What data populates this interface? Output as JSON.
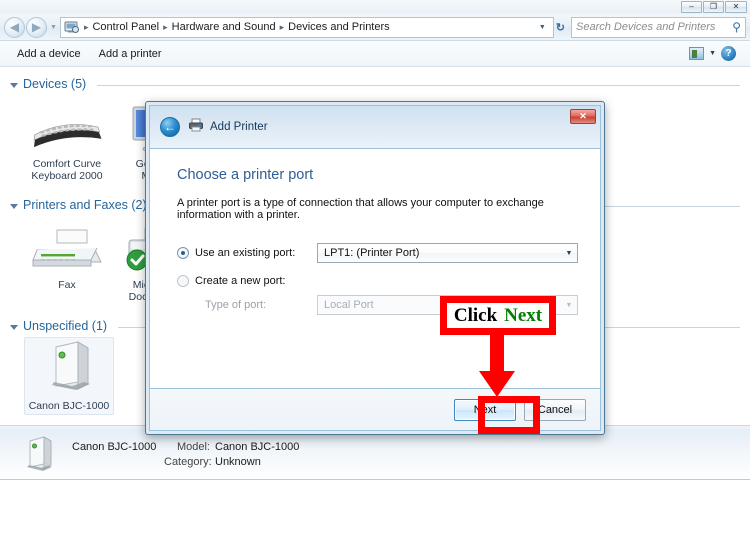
{
  "window": {
    "controls": [
      {
        "name": "minimize",
        "glyph": "–"
      },
      {
        "name": "maximize",
        "glyph": "❐"
      },
      {
        "name": "close",
        "glyph": "✕"
      }
    ]
  },
  "address_bar": {
    "back_glyph": "◀",
    "forward_glyph": "▶",
    "dropdown_glyph": "▼",
    "breadcrumbs": [
      "Control Panel",
      "Hardware and Sound",
      "Devices and Printers"
    ],
    "separator": "▸",
    "caret_glyph": "▼",
    "refresh_glyph": "↻",
    "search": {
      "placeholder": "Search Devices and Printers",
      "value": "",
      "icon": "search-icon",
      "glyph": "⚲"
    }
  },
  "command_bar": {
    "items": [
      {
        "label": "Add a device",
        "name": "add-a-device"
      },
      {
        "label": "Add a printer",
        "name": "add-a-printer"
      }
    ],
    "view_caret": "▼",
    "help_label": "?"
  },
  "content": {
    "groups": [
      {
        "title": "Devices (5)",
        "name": "devices",
        "items": [
          {
            "label": "Comfort Curve\nKeyboard 2000",
            "line1": "Comfort Curve",
            "line2": "Keyboard 2000",
            "icon": "keyboard-icon",
            "selected": false
          },
          {
            "label": "Generic PnP\nMonitor",
            "line1": "Generic P",
            "line2": "Monitor",
            "icon": "monitor-icon",
            "selected": false
          }
        ]
      },
      {
        "title": "Printers and Faxes (2)",
        "name": "printers-and-faxes",
        "items": [
          {
            "line1": "Fax",
            "line2": "",
            "icon": "fax-icon",
            "selected": false
          },
          {
            "line1": "Microsoft X",
            "line2": "Document W",
            "icon": "printer-default-icon",
            "selected": false
          }
        ]
      },
      {
        "title": "Unspecified (1)",
        "name": "unspecified",
        "items": [
          {
            "line1": "Canon BJC-1000",
            "line2": "",
            "icon": "device-tower-icon",
            "selected": true
          }
        ]
      }
    ]
  },
  "details_pane": {
    "device_name": "Canon BJC-1000",
    "model_key": "Model:",
    "model_value": "Canon BJC-1000",
    "category_key": "Category:",
    "category_value": "Unknown",
    "icon": "device-tower-icon"
  },
  "dialog": {
    "title": "Add Printer",
    "back_glyph": "←",
    "close_glyph": "✕",
    "heading": "Choose a printer port",
    "description": "A printer port is a type of connection that allows your computer to exchange information with a printer.",
    "existing_port": {
      "label": "Use an existing port:",
      "checked": true,
      "value": "LPT1: (Printer Port)",
      "arrow": "▼"
    },
    "new_port": {
      "label": "Create a new port:",
      "checked": false,
      "type_label": "Type of port:",
      "value": "Local Port",
      "arrow": "▼"
    },
    "buttons": [
      {
        "label": "Next",
        "name": "next-button",
        "default": true
      },
      {
        "label": "Cancel",
        "name": "cancel-button",
        "default": false
      }
    ]
  },
  "annotation": {
    "word1": "Click",
    "word2": "Next",
    "color_text": "#000000",
    "color_highlight": "#008000",
    "color_border": "#ff0000"
  }
}
